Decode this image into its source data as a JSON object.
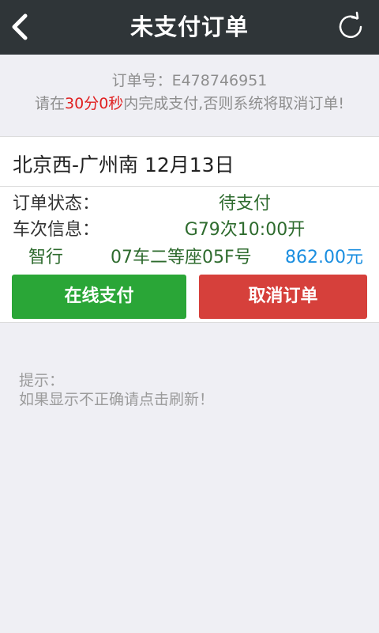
{
  "header": {
    "title": "未支付订单",
    "back_icon": "chevron-left-icon",
    "refresh_icon": "refresh-icon"
  },
  "order_info": {
    "order_number_label": "订单号：E478746951",
    "warning_prefix": "请在",
    "countdown": "30分0秒",
    "warning_suffix": "内完成支付,否则系统将取消订单!"
  },
  "trip": {
    "route": "北京西-广州南 12月13日",
    "status_label": "订单状态：",
    "status_value": "待支付",
    "train_label": "车次信息：",
    "train_value": "G79次10:00开",
    "passenger_type": "智行",
    "seat": "07车二等座05F号",
    "price": "862.00元"
  },
  "actions": {
    "pay_label": "在线支付",
    "cancel_label": "取消订单"
  },
  "tips": {
    "title": "提示：",
    "text": "如果显示不正确请点击刷新！"
  },
  "colors": {
    "header_bg": "#2f3538",
    "pay_button": "#2aa637",
    "cancel_button": "#d6403b",
    "countdown": "#e02020",
    "price": "#1a8ee0",
    "value_green": "#2e6b2e"
  }
}
